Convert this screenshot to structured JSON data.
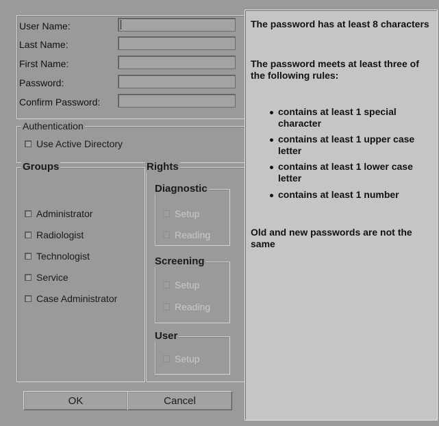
{
  "user_form": {
    "user_name_label": "User Name:",
    "last_name_label": "Last Name:",
    "first_name_label": "First Name:",
    "password_label": "Password:",
    "confirm_password_label": "Confirm Password:",
    "user_name_value": "",
    "last_name_value": "",
    "first_name_value": "",
    "password_value": "",
    "confirm_password_value": ""
  },
  "authentication": {
    "legend": "Authentication",
    "use_active_directory_label": "Use Active Directory",
    "use_active_directory_checked": false
  },
  "groups": {
    "legend": "Groups",
    "items": [
      {
        "label": "Administrator",
        "checked": false
      },
      {
        "label": "Radiologist",
        "checked": false
      },
      {
        "label": "Technologist",
        "checked": false
      },
      {
        "label": "Service",
        "checked": false
      },
      {
        "label": "Case Administrator",
        "checked": false
      }
    ]
  },
  "rights": {
    "legend": "Rights",
    "diagnostic": {
      "legend": "Diagnostic",
      "setup": "Setup",
      "reading": "Reading"
    },
    "screening": {
      "legend": "Screening",
      "setup": "Setup",
      "reading": "Reading"
    },
    "user": {
      "legend": "User",
      "setup": "Setup"
    }
  },
  "buttons": {
    "ok": "OK",
    "cancel": "Cancel"
  },
  "password_rules": {
    "min_length": "The password has at least 8 characters",
    "intro": "The password meets at least three of the following rules:",
    "rules": [
      "contains at least 1 special character",
      "contains at least 1 upper case letter",
      "contains at least 1 lower case letter",
      "contains at least 1 number"
    ],
    "not_same": "Old and new passwords are not the same"
  }
}
